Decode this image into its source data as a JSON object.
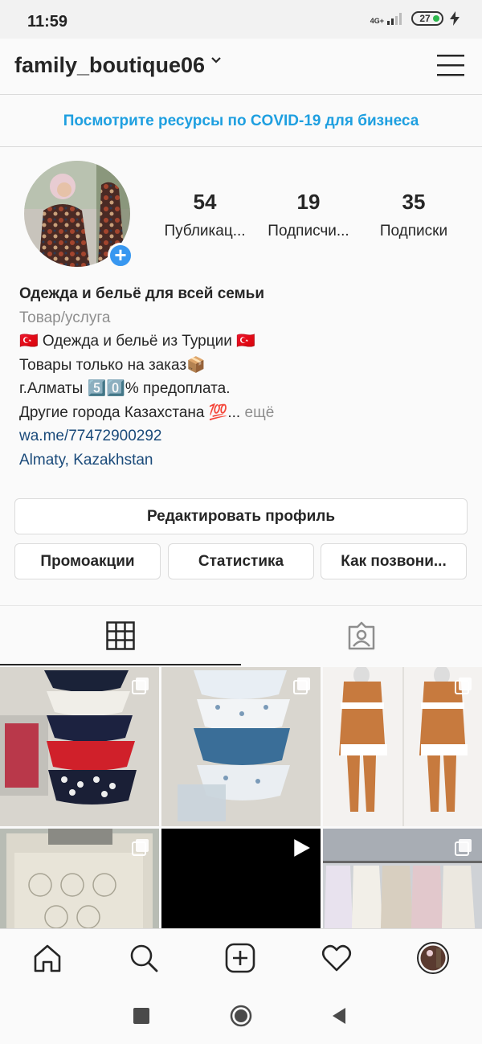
{
  "status_bar": {
    "time": "11:59",
    "network": "4G+",
    "battery": "27"
  },
  "header": {
    "username": "family_boutique06"
  },
  "banner": {
    "text": "Посмотрите ресурсы по COVID-19 для бизнеса",
    "color": "#1e9fe0"
  },
  "stats": [
    {
      "value": "54",
      "label": "Публикац..."
    },
    {
      "value": "19",
      "label": "Подписчи..."
    },
    {
      "value": "35",
      "label": "Подписки"
    }
  ],
  "bio": {
    "name": "Одежда и бельё для всей семьи",
    "category": "Товар/услуга",
    "line1": "🇹🇷 Одежда и бельё из Турции 🇹🇷",
    "line2": "Товары только на заказ📦",
    "line3": "г.Алматы 5️⃣0️⃣% предоплата.",
    "line4": "Другие города Казахстана 💯...",
    "more": " ещё",
    "link": "wa.me/77472900292",
    "location": "Almaty, Kazakhstan"
  },
  "buttons": {
    "edit_profile": "Редактировать профиль",
    "promotions": "Промоакции",
    "insights": "Статистика",
    "contact": "Как позвони..."
  },
  "tabs": [
    {
      "icon": "grid-icon",
      "active": true
    },
    {
      "icon": "tagged-icon",
      "active": false
    }
  ],
  "grid": [
    {
      "subject": "underwear",
      "type": "carousel"
    },
    {
      "subject": "underwear",
      "type": "carousel"
    },
    {
      "subject": "tracksuit",
      "type": "carousel"
    },
    {
      "subject": "boxed-set",
      "type": "carousel"
    },
    {
      "subject": "black",
      "type": "video"
    },
    {
      "subject": "dresses",
      "type": "carousel"
    }
  ],
  "bottom_nav": [
    "home-icon",
    "search-icon",
    "add-icon",
    "heart-icon",
    "profile-avatar"
  ],
  "colors": {
    "accent": "#3897f0",
    "link": "#1a4a7a",
    "text": "#262626",
    "muted": "#8e8e8e"
  }
}
